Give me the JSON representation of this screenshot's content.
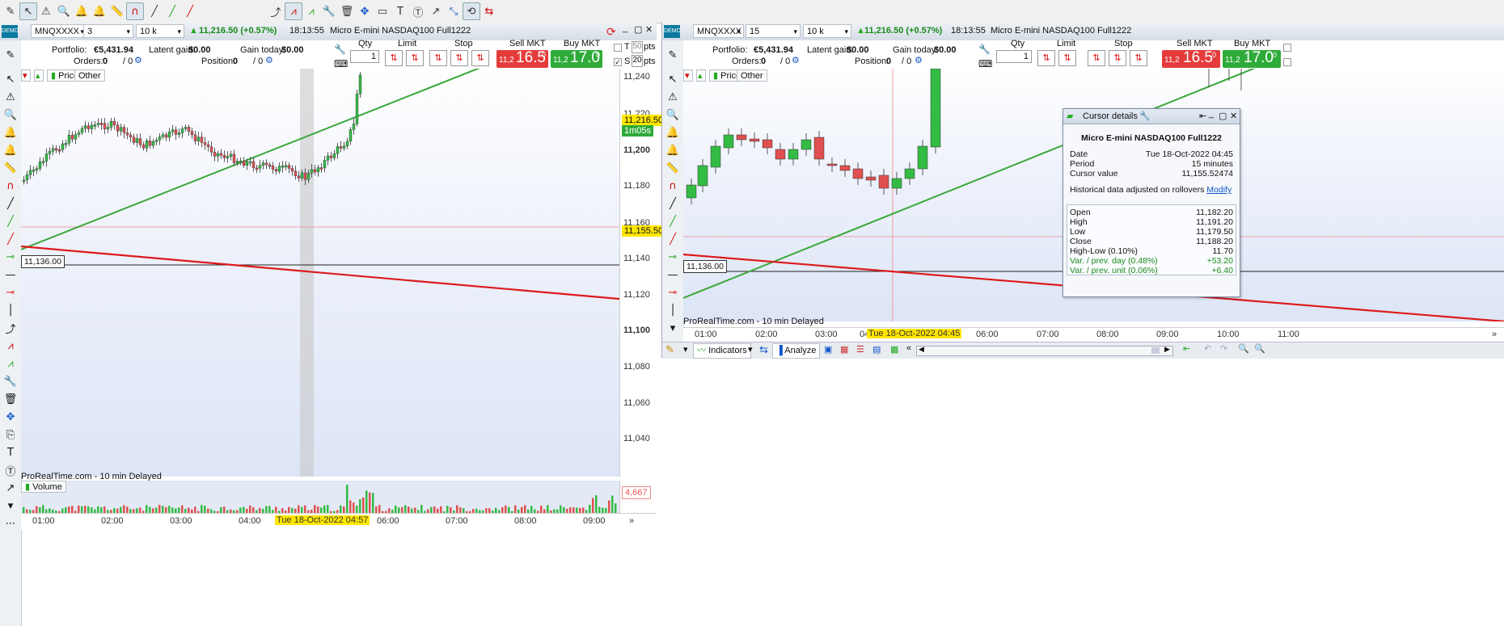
{
  "toolbar": {
    "tools": [
      "drawing-pencil-icon",
      "cursor-icon",
      "alert-bell-icon",
      "zoom-icon",
      "bell-icon",
      "alert-bell-icon",
      "ruler-icon",
      "magnet-icon",
      "line-icon",
      "line-green-icon",
      "line-red-icon",
      "trend-icon",
      "channel-icon",
      "wrench-icon",
      "trash-icon",
      "move-icon",
      "text-icon",
      "text-circle-icon",
      "arrow-icon",
      "select-icon",
      "channel-red-icon"
    ]
  },
  "left": {
    "symbol": "MNQXXXX",
    "period": "3 minutes",
    "units": "10 k units",
    "price_change": "11,216.50 (+0.57%)",
    "time": "18:13:55",
    "instrument": "Micro E-mini NASDAQ100 Full1222",
    "portfolio_label": "Portfolio:",
    "portfolio_value": "€5,431.94",
    "latent_label": "Latent gain:",
    "latent_value": "$0.00",
    "gain_today_label": "Gain today:",
    "gain_today_value": "$0.00",
    "orders_label": "Orders:",
    "orders_value": "0",
    "orders_slash": "/ 0",
    "position_label": "Position:",
    "position_value": "0",
    "position_slash": "/ 0",
    "qty_label": "Qty",
    "qty_value": "1",
    "limit_label": "Limit",
    "stop_label": "Stop",
    "sell_label": "Sell MKT",
    "sell_small": "11,2",
    "sell_big": "16.5",
    "sell_sup": "0",
    "buy_label": "Buy MKT",
    "buy_small": "11,2",
    "buy_big": "17.0",
    "buy_sup": "0",
    "t_label": "T",
    "t_value": "50",
    "s_label": "S",
    "s_value": "20",
    "pts": "pts",
    "price_tab": "Price",
    "other_tab": "Other",
    "yticks": [
      "11,240",
      "11,220",
      "11,200",
      "11,180",
      "11,160",
      "11,140",
      "11,120",
      "11,100",
      "11,080",
      "11,060",
      "11,040"
    ],
    "last_price": "11,216.50",
    "countdown": "1m05s",
    "cursor_price": "11,155.50",
    "hline_label": "11,136.00",
    "delayed": "ProRealTime.com - 10 min Delayed",
    "volume_tab": "Volume",
    "volume_value": "4,667",
    "xticks": [
      "01:00",
      "02:00",
      "03:00",
      "04:00",
      "06:00",
      "07:00",
      "08:00",
      "09:00"
    ],
    "cursor_date": "Tue 18-Oct-2022 04:57"
  },
  "right": {
    "symbol": "MNQXXXX",
    "period": "15 minutes",
    "units": "10 k units",
    "price_change": "11,216.50 (+0.57%)",
    "time": "18:13:55",
    "instrument": "Micro E-mini NASDAQ100 Full1222",
    "portfolio_label": "Portfolio:",
    "portfolio_value": "€5,431.94",
    "latent_label": "Latent gain:",
    "latent_value": "$0.00",
    "gain_today_label": "Gain today:",
    "gain_today_value": "$0.00",
    "orders_label": "Orders:",
    "orders_value": "0",
    "orders_slash": "/ 0",
    "position_label": "Position:",
    "position_value": "0",
    "position_slash": "/ 0",
    "qty_label": "Qty",
    "qty_value": "1",
    "limit_label": "Limit",
    "stop_label": "Stop",
    "sell_label": "Sell MKT",
    "sell_small": "11,2",
    "sell_big": "16.5",
    "sell_sup": "0",
    "buy_label": "Buy MKT",
    "buy_small": "11,2",
    "buy_big": "17.0",
    "buy_sup": "0",
    "price_tab": "Price",
    "other_tab": "Other",
    "hline_label": "11,136.00",
    "delayed": "ProRealTime.com - 10 min Delayed",
    "xticks": [
      "01:00",
      "02:00",
      "03:00",
      "04",
      "06:00",
      "07:00",
      "08:00",
      "09:00",
      "10:00",
      "11:00"
    ],
    "cursor_date": "Tue 18-Oct-2022 04:45",
    "indicators_label": "Indicators",
    "analyze_label": "Analyze"
  },
  "cursor_details": {
    "title": "Cursor details",
    "instrument": "Micro E-mini NASDAQ100 Full1222",
    "date_label": "Date",
    "date_value": "Tue 18-Oct-2022 04:45",
    "period_label": "Period",
    "period_value": "15 minutes",
    "cursor_label": "Cursor value",
    "cursor_value": "11,155.52474",
    "note": "Historical data adjusted on rollovers",
    "modify": "Modify",
    "rows": [
      {
        "k": "Open",
        "v": "11,182.20",
        "color": "#111111"
      },
      {
        "k": "High",
        "v": "11,191.20",
        "color": "#111111"
      },
      {
        "k": "Low",
        "v": "11,179.50",
        "color": "#111111"
      },
      {
        "k": "Close",
        "v": "11,188.20",
        "color": "#111111"
      },
      {
        "k": "High-Low (0.10%)",
        "v": "11.70",
        "color": "#111111"
      },
      {
        "k": "Var. / prev. day (0.48%)",
        "v": "+53.20",
        "color": "#1a8a1a"
      },
      {
        "k": "Var. / prev. unit (0.06%)",
        "v": "+6.40",
        "color": "#1a8a1a"
      }
    ]
  },
  "colors": {
    "up": "#33bb44",
    "down": "#e05050",
    "trend_green": "#3aa83a",
    "trend_red": "#dd1a1a"
  }
}
